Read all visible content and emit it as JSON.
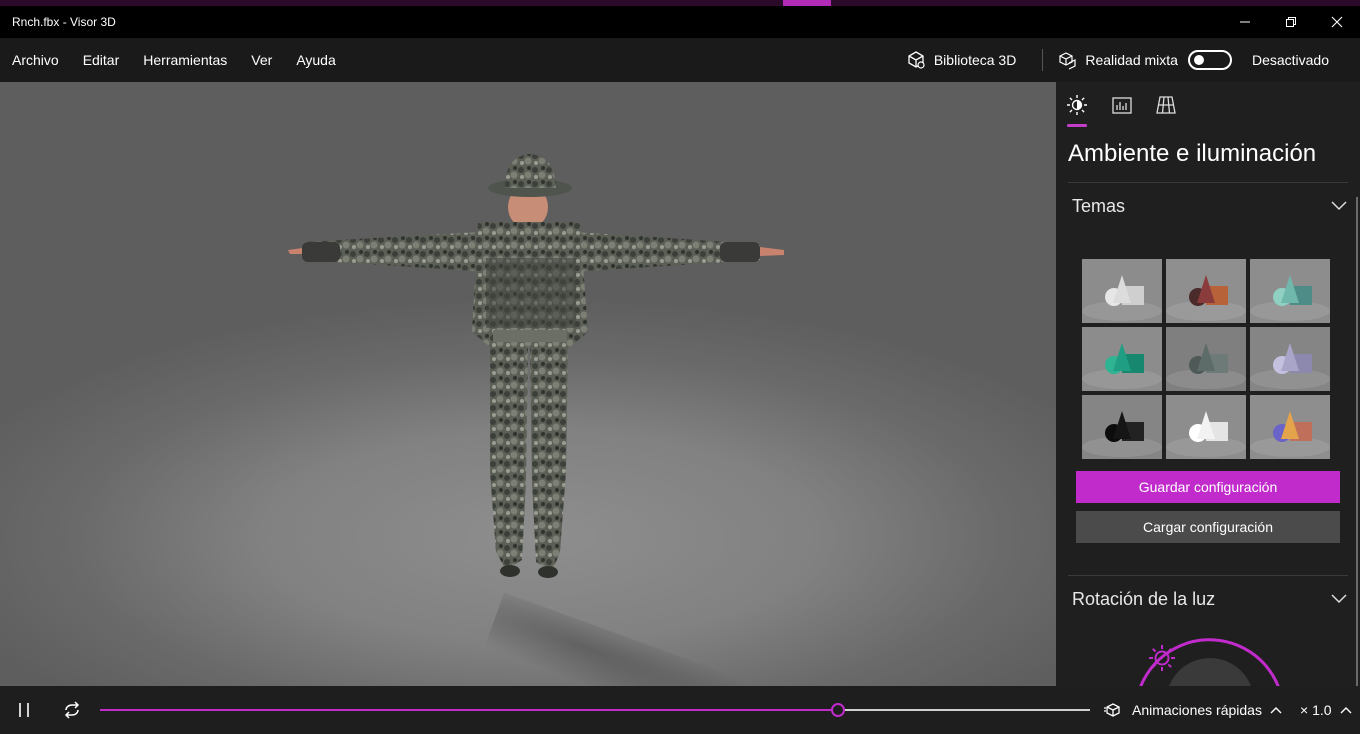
{
  "window": {
    "title": "Rnch.fbx - Visor 3D",
    "accent_color": "#c12bcc"
  },
  "menu": {
    "items": [
      {
        "label": "Archivo"
      },
      {
        "label": "Editar"
      },
      {
        "label": "Herramientas"
      },
      {
        "label": "Ver"
      },
      {
        "label": "Ayuda"
      }
    ],
    "library_label": "Biblioteca 3D",
    "mixed_reality_label": "Realidad mixta",
    "mixed_reality_state": "Desactivado",
    "mixed_reality_on": false
  },
  "panel": {
    "tabs": [
      {
        "icon": "sun-icon",
        "active": true
      },
      {
        "icon": "stats-icon",
        "active": false
      },
      {
        "icon": "grid-icon",
        "active": false
      }
    ],
    "title": "Ambiente e iluminación",
    "themes_section": "Temas",
    "themes": [
      {
        "name": "gris-claro",
        "bg": "#8c8c8c",
        "a": "#dcdcdc",
        "b": "#cfcfcf",
        "c": "#e6e6e6"
      },
      {
        "name": "calido",
        "bg": "#8f8f8f",
        "a": "#8a3b3b",
        "b": "#b8623a",
        "c": "#4a2a2a"
      },
      {
        "name": "turquesa",
        "bg": "#8d8d8d",
        "a": "#6fb8ab",
        "b": "#4e8c88",
        "c": "#8fd0c2"
      },
      {
        "name": "esmeralda",
        "bg": "#8c8c8c",
        "a": "#1f9e83",
        "b": "#17876f",
        "c": "#2fb493"
      },
      {
        "name": "pizarra",
        "bg": "#7f7f7f",
        "a": "#5d6b69",
        "b": "#6e7a78",
        "c": "#4f5a58"
      },
      {
        "name": "lavanda",
        "bg": "#858585",
        "a": "#a9a5c9",
        "b": "#8d89ae",
        "c": "#c4c0df"
      },
      {
        "name": "negro",
        "bg": "#858585",
        "a": "#151515",
        "b": "#222222",
        "c": "#0c0c0c"
      },
      {
        "name": "blanco",
        "bg": "#8d8d8d",
        "a": "#f2f2f2",
        "b": "#e4e4e4",
        "c": "#ffffff"
      },
      {
        "name": "multicolor",
        "bg": "#8e8e8e",
        "a": "#e3a44b",
        "b": "#c0705a",
        "c": "#6a63c8"
      }
    ],
    "save_button": "Guardar configuración",
    "load_button": "Cargar configuración",
    "light_rotation_section": "Rotación de la luz"
  },
  "playback": {
    "progress": 0.745,
    "animation_label": "Animaciones rápidas",
    "speed_label": "× 1.0"
  }
}
